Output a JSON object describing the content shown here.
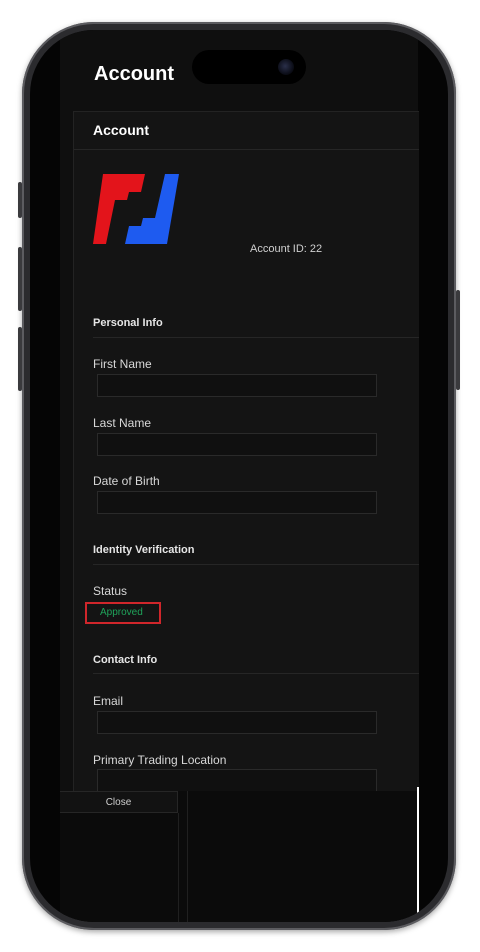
{
  "header": {
    "title": "Account"
  },
  "card": {
    "title": "Account"
  },
  "account": {
    "id_label": "Account ID: 22"
  },
  "sections": {
    "personal": "Personal Info",
    "identity": "Identity Verification",
    "contact": "Contact Info"
  },
  "fields": {
    "first_name": {
      "label": "First Name",
      "value": ""
    },
    "last_name": {
      "label": "Last Name",
      "value": ""
    },
    "dob": {
      "label": "Date of Birth",
      "value": ""
    },
    "email": {
      "label": "Email",
      "value": ""
    },
    "location": {
      "label": "Primary Trading Location",
      "value": ""
    }
  },
  "status": {
    "label": "Status",
    "value": "Approved",
    "color": "#1fa35a",
    "highlight": "#d0262b"
  },
  "footer": {
    "close_label": "Close"
  },
  "logo": {
    "left_color": "#e3141b",
    "right_color": "#1e5bf0",
    "icon": "exchange-logo"
  }
}
